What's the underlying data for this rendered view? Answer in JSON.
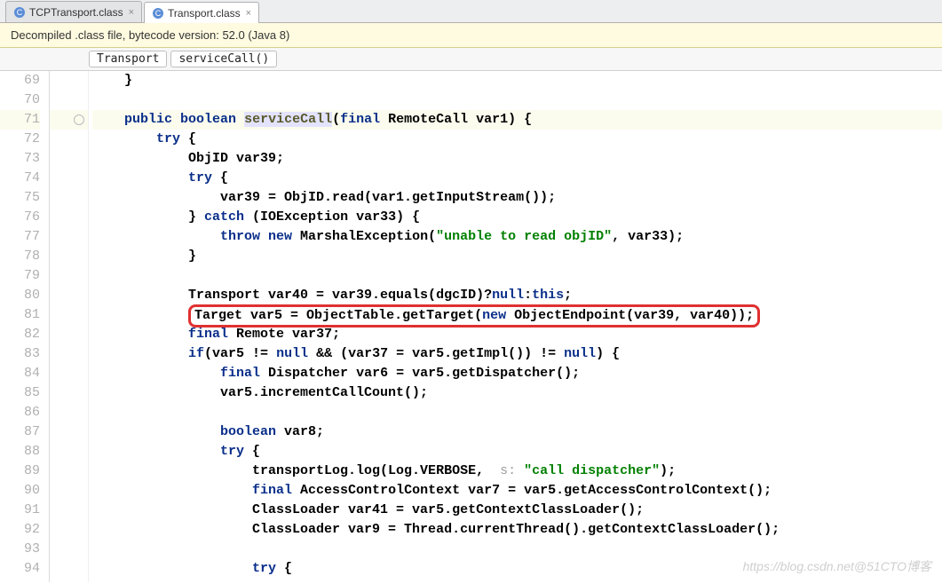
{
  "tabs": [
    {
      "label": "TCPTransport.class",
      "active": false
    },
    {
      "label": "Transport.class",
      "active": true
    }
  ],
  "banner": "Decompiled .class file, bytecode version: 52.0 (Java 8)",
  "breadcrumb": [
    "Transport",
    "serviceCall()"
  ],
  "gutter_start": 69,
  "gutter_end": 94,
  "highlight_line": 71,
  "boxed_line": 81,
  "code": {
    "l69": "    }",
    "l70": "",
    "l71": {
      "pre": "    ",
      "kw1": "public",
      "kw2": "boolean",
      "name": "serviceCall",
      "sig": "(",
      "kw3": "final",
      "type": "RemoteCall",
      "rest": " var1) {"
    },
    "l72": {
      "pre": "        ",
      "kw": "try",
      "rest": " {"
    },
    "l73": "            ObjID var39;",
    "l74": {
      "pre": "            ",
      "kw": "try",
      "rest": " {"
    },
    "l75": "                var39 = ObjID.read(var1.getInputStream());",
    "l76": {
      "pre": "            } ",
      "kw": "catch",
      "rest": " (IOException var33) {"
    },
    "l77": {
      "pre": "                ",
      "kw": "throw new",
      "mid": " MarshalException(",
      "str": "\"unable to read objID\"",
      "rest": ", var33);"
    },
    "l78": "            }",
    "l79": "",
    "l80": {
      "pre": "            Transport var40 = var39.equals(dgcID)?",
      "kw": "null",
      "mid": ":",
      "kw2": "this",
      "rest": ";"
    },
    "l81": {
      "pre": "            ",
      "boxed_pre": "Target var5 = ObjectTable.getTarget(",
      "kw": "new",
      "boxed_post": " ObjectEndpoint(var39, var40));"
    },
    "l82": {
      "pre": "            ",
      "kw": "final",
      "rest": " Remote var37;"
    },
    "l83": {
      "pre": "            ",
      "kw": "if",
      "mid": "(var5 != ",
      "kw2": "null",
      "mid2": " && (var37 = var5.getImpl()) != ",
      "kw3": "null",
      "rest": ") {"
    },
    "l84": {
      "pre": "                ",
      "kw": "final",
      "rest": " Dispatcher var6 = var5.getDispatcher();"
    },
    "l85": "                var5.incrementCallCount();",
    "l86": "",
    "l87": {
      "pre": "                ",
      "kw": "boolean",
      "rest": " var8;"
    },
    "l88": {
      "pre": "                ",
      "kw": "try",
      "rest": " {"
    },
    "l89": {
      "pre": "                    transportLog.log(Log.VERBOSE, ",
      "hint": " s: ",
      "str": "\"call dispatcher\"",
      "rest": ");"
    },
    "l90": {
      "pre": "                    ",
      "kw": "final",
      "rest": " AccessControlContext var7 = var5.getAccessControlContext();"
    },
    "l91": "                    ClassLoader var41 = var5.getContextClassLoader();",
    "l92": "                    ClassLoader var9 = Thread.currentThread().getContextClassLoader();",
    "l93": "",
    "l94": {
      "pre": "                    ",
      "kw": "try",
      "rest": " {"
    }
  },
  "watermark": "https://blog.csdn.net@51CTO博客"
}
